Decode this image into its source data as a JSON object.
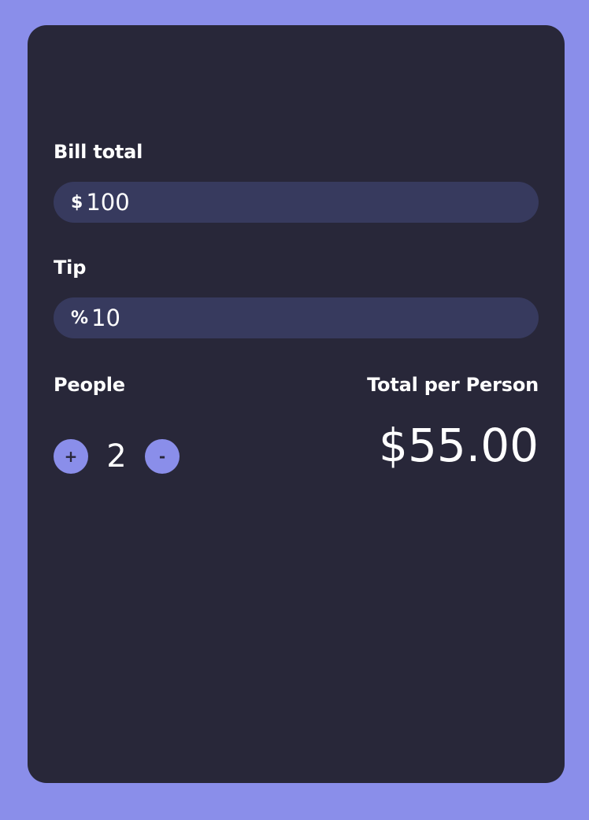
{
  "colors": {
    "background": "#8a8eea",
    "card": "#282739",
    "input": "#373a5e",
    "accent": "#8a8eea",
    "text": "#ffffff"
  },
  "bill": {
    "label": "Bill total",
    "prefix": "$",
    "value": "100"
  },
  "tip": {
    "label": "Tip",
    "prefix": "%",
    "value": "10"
  },
  "people": {
    "label": "People",
    "increment_label": "+",
    "count": "2",
    "decrement_label": "-"
  },
  "result": {
    "label": "Total per Person",
    "value": "$55.00"
  }
}
